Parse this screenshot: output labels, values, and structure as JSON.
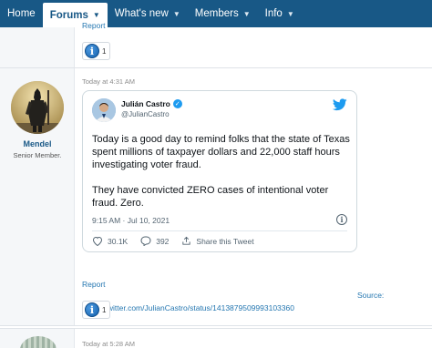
{
  "nav": {
    "tabs": [
      {
        "label": "Home",
        "chevron": false
      },
      {
        "label": "Forums",
        "chevron": true
      },
      {
        "label": "What's new",
        "chevron": true
      },
      {
        "label": "Members",
        "chevron": true
      },
      {
        "label": "Info",
        "chevron": true
      }
    ],
    "active_tab": "Forums",
    "bar_color": "#185886"
  },
  "prev_post": {
    "report_label": "Report",
    "reaction_count": "1"
  },
  "post": {
    "timestamp": "Today at 4:31 AM",
    "username": "Mendel",
    "user_title": "Senior Member.",
    "tweet": {
      "display_name": "Julián Castro",
      "handle": "@JulianCastro",
      "paragraph_1": "Today is a good day to remind folks that the state of Texas spent millions of taxpayer dollars and 22,000 staff hours investigating voter fraud.",
      "paragraph_2": "They have convicted ZERO cases of intentional voter fraud. Zero.",
      "time": "9:15 AM · Jul 10, 2021",
      "likes": "30.1K",
      "replies": "392",
      "share_label": "Share this Tweet",
      "brand_color": "#1d9bf0"
    },
    "source_label": "Source:",
    "source_url": "https://twitter.com/JulianCastro/status/1413879509993103360",
    "report_label": "Report",
    "reaction_count": "1"
  },
  "next_post": {
    "timestamp": "Today at 5:28 AM"
  }
}
